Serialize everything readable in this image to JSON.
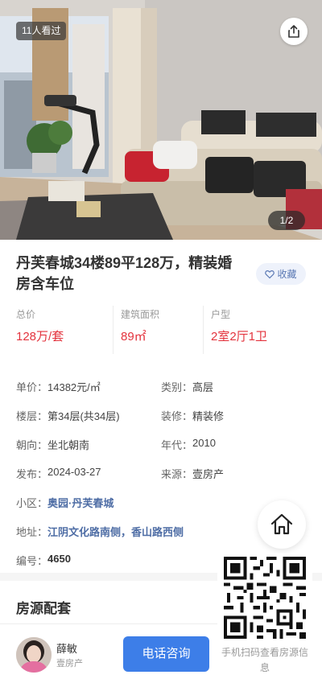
{
  "hero": {
    "views_badge": "11人看过",
    "photo_counter": "1/2",
    "share_icon": "share-icon"
  },
  "listing": {
    "title": "丹芙春城34楼89平128万，精装婚房含车位",
    "favorite_label": "收藏",
    "favorite_icon": "heart-outline-icon"
  },
  "stats": [
    {
      "label": "总价",
      "value": "128万/套"
    },
    {
      "label": "建筑面积",
      "value": "89㎡"
    },
    {
      "label": "户型",
      "value": "2室2厅1卫"
    }
  ],
  "details": {
    "unit_price": {
      "label": "单价：",
      "value": "14382元/㎡"
    },
    "category": {
      "label": "类别：",
      "value": "高层"
    },
    "floor": {
      "label": "楼层：",
      "value": "第34层(共34层)"
    },
    "decoration": {
      "label": "装修：",
      "value": "精装修"
    },
    "orientation": {
      "label": "朝向：",
      "value": "坐北朝南"
    },
    "year": {
      "label": "年代：",
      "value": "2010"
    },
    "published": {
      "label": "发布：",
      "value": "2024-03-27"
    },
    "source": {
      "label": "来源：",
      "value": "壹房产"
    },
    "community": {
      "label": "小区：",
      "value": "奥园·丹芙春城"
    },
    "address": {
      "label": "地址：",
      "value": "江阴文化路南侧，香山路西侧"
    },
    "id": {
      "label": "编号：",
      "value": "4650"
    }
  },
  "section": {
    "facilities_title": "房源配套"
  },
  "floating": {
    "home_icon": "home-icon",
    "qr_caption": "手机扫码查看房源信息"
  },
  "agent": {
    "name": "薛敏",
    "company": "壹房产",
    "call_label": "电话咨询"
  },
  "colors": {
    "price_red": "#e3333d",
    "link_blue": "#4e6da5",
    "call_button": "#3d7ee8",
    "favorite_bg": "#eef2fb"
  }
}
